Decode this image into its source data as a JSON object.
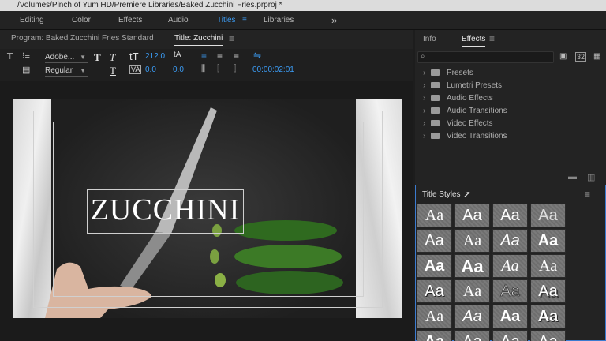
{
  "titlebar": {
    "path": "/Volumes/Pinch of Yum HD/Premiere Libraries/Baked Zucchini Fries.prproj *"
  },
  "workspaces": {
    "items": [
      "Editing",
      "Color",
      "Effects",
      "Audio",
      "Titles",
      "Libraries"
    ],
    "active": "Titles",
    "more_glyph": "»"
  },
  "program_panel": {
    "tab_program": "Program: Baked Zucchini Fries Standard",
    "tab_title": "Title: Zucchini"
  },
  "title_toolbar": {
    "font_family": "Adobe...",
    "font_style": "Regular",
    "font_size": "212.0",
    "kerning": "0.0",
    "leading": "0.0",
    "timecode": "00:00:02:01"
  },
  "canvas": {
    "title_text": "ZUCCHINI"
  },
  "effects_panel": {
    "tab_info": "Info",
    "tab_effects": "Effects",
    "items": [
      "Presets",
      "Lumetri Presets",
      "Audio Effects",
      "Audio Transitions",
      "Video Effects",
      "Video Transitions"
    ]
  },
  "title_styles": {
    "header": "Title Styles",
    "swatch_label": "Aa"
  },
  "colors": {
    "accent": "#3b9cf5",
    "panel_bg": "#232323",
    "selected_border": "#3b7bd0"
  }
}
